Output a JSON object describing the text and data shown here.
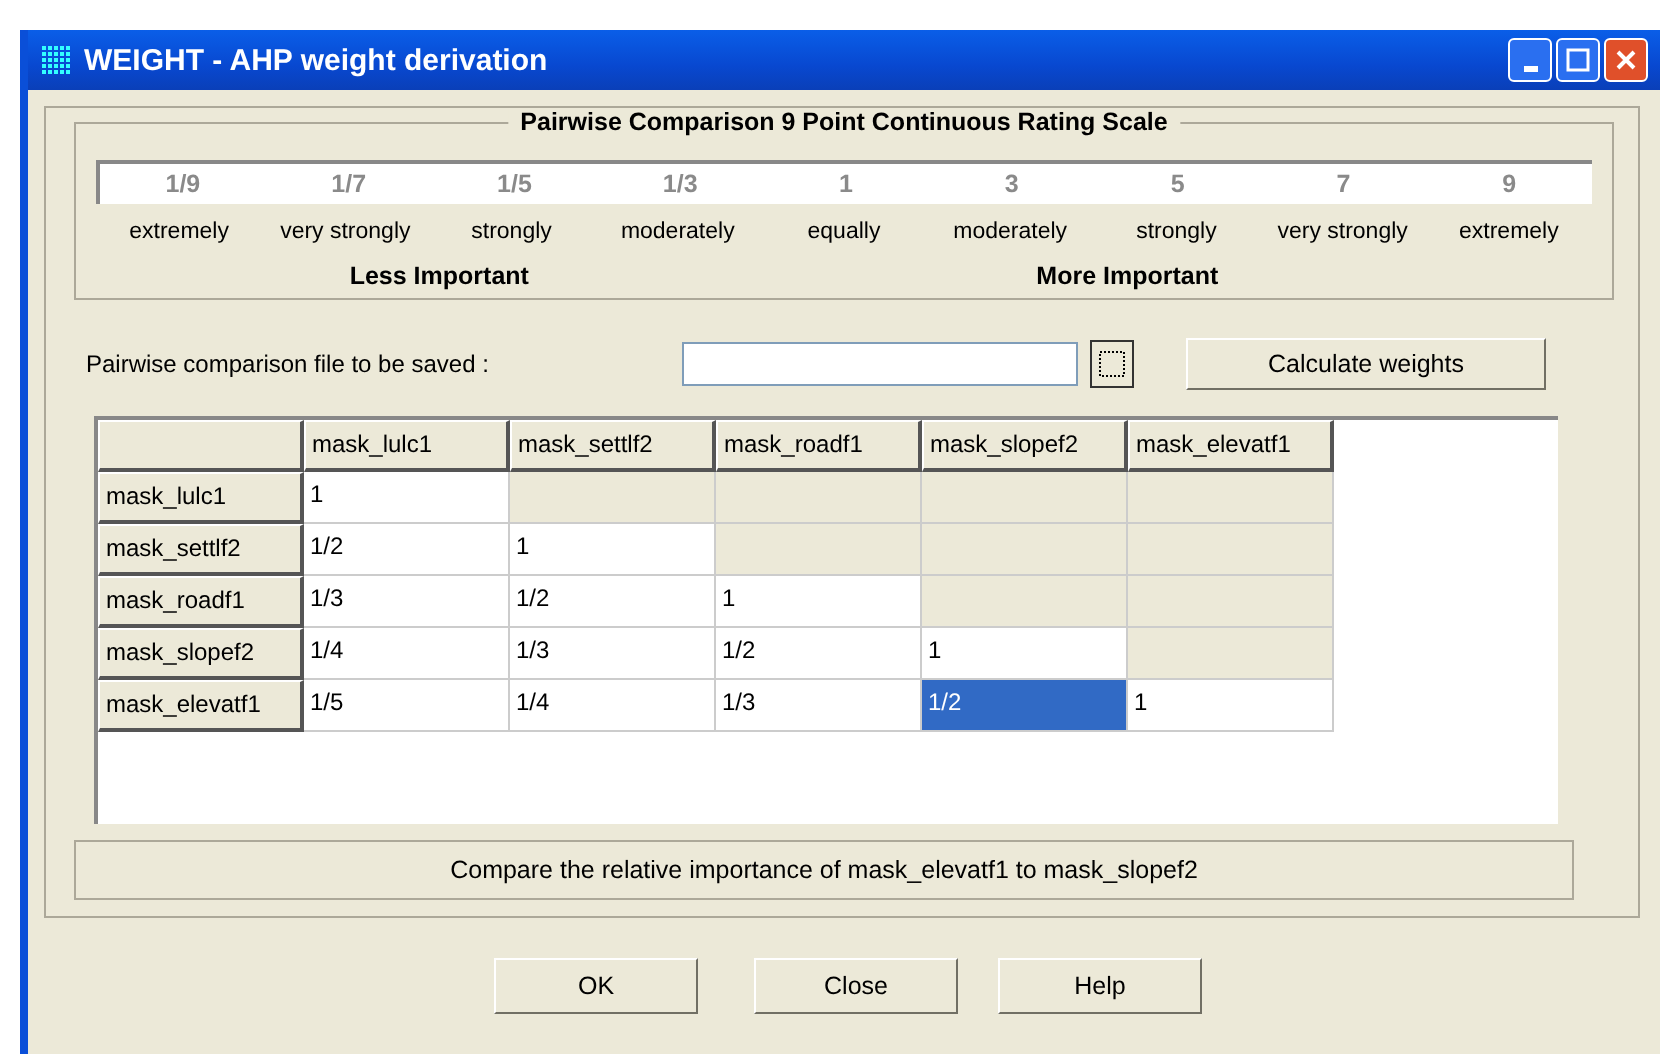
{
  "window": {
    "title": "WEIGHT - AHP weight derivation"
  },
  "scale": {
    "title": "Pairwise Comparison 9 Point Continuous Rating Scale",
    "values": [
      "1/9",
      "1/7",
      "1/5",
      "1/3",
      "1",
      "3",
      "5",
      "7",
      "9"
    ],
    "descriptions": [
      "extremely",
      "very strongly",
      "strongly",
      "moderately",
      "equally",
      "moderately",
      "strongly",
      "very strongly",
      "extremely"
    ],
    "less_label": "Less Important",
    "more_label": "More Important"
  },
  "file": {
    "label": "Pairwise comparison file to be saved :",
    "calculate_button": "Calculate weights"
  },
  "table": {
    "columns": [
      "mask_lulc1",
      "mask_settlf2",
      "mask_roadf1",
      "mask_slopef2",
      "mask_elevatf1"
    ],
    "rows": [
      {
        "header": "mask_lulc1",
        "cells": [
          {
            "text": "1",
            "selected": false,
            "disabled": false
          },
          {
            "selected": false,
            "disabled": true
          },
          {
            "selected": false,
            "disabled": true
          },
          {
            "selected": false,
            "disabled": true
          },
          {
            "selected": false,
            "disabled": true
          }
        ]
      },
      {
        "header": "mask_settlf2",
        "cells": [
          {
            "text": "1/2",
            "selected": false,
            "disabled": false
          },
          {
            "text": "1",
            "selected": false,
            "disabled": false
          },
          {
            "selected": false,
            "disabled": true
          },
          {
            "selected": false,
            "disabled": true
          },
          {
            "selected": false,
            "disabled": true
          }
        ]
      },
      {
        "header": "mask_roadf1",
        "cells": [
          {
            "text": "1/3",
            "selected": false,
            "disabled": false
          },
          {
            "text": "1/2",
            "selected": false,
            "disabled": false
          },
          {
            "text": "1",
            "selected": false,
            "disabled": false
          },
          {
            "selected": false,
            "disabled": true
          },
          {
            "selected": false,
            "disabled": true
          }
        ]
      },
      {
        "header": "mask_slopef2",
        "cells": [
          {
            "text": "1/4",
            "selected": false,
            "disabled": false
          },
          {
            "text": "1/3",
            "selected": false,
            "disabled": false
          },
          {
            "text": "1/2",
            "selected": false,
            "disabled": false
          },
          {
            "text": "1",
            "selected": false,
            "disabled": false
          },
          {
            "selected": false,
            "disabled": true
          }
        ]
      },
      {
        "header": "mask_elevatf1",
        "cells": [
          {
            "text": "1/5",
            "selected": false,
            "disabled": false
          },
          {
            "text": "1/4",
            "selected": false,
            "disabled": false
          },
          {
            "text": "1/3",
            "selected": false,
            "disabled": false
          },
          {
            "text": "1/2",
            "selected": true,
            "disabled": false
          },
          {
            "text": "1",
            "selected": false,
            "disabled": false
          }
        ]
      }
    ]
  },
  "status": "Compare the relative importance of mask_elevatf1 to mask_slopef2",
  "buttons": [
    "OK",
    "Close",
    "Help"
  ]
}
